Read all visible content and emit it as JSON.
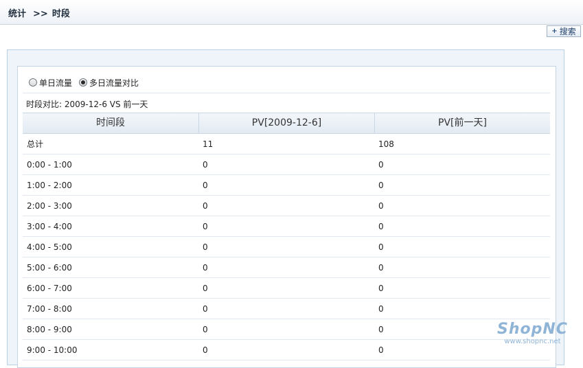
{
  "breadcrumb": {
    "root": "统计",
    "separator": ">>",
    "current": "时段"
  },
  "toolbar": {
    "search_plus": "+",
    "search_label": "搜索"
  },
  "mode": {
    "options": [
      {
        "label": "单日流量",
        "selected": false
      },
      {
        "label": "多日流量对比",
        "selected": true
      }
    ]
  },
  "compare_text": "时段对比: 2009-12-6 VS 前一天",
  "table": {
    "headers": [
      "时间段",
      "PV[2009-12-6]",
      "PV[前一天]"
    ],
    "rows": [
      [
        "总计",
        "11",
        "108"
      ],
      [
        "0:00 - 1:00",
        "0",
        "0"
      ],
      [
        "1:00 - 2:00",
        "0",
        "0"
      ],
      [
        "2:00 - 3:00",
        "0",
        "0"
      ],
      [
        "3:00 - 4:00",
        "0",
        "0"
      ],
      [
        "4:00 - 5:00",
        "0",
        "0"
      ],
      [
        "5:00 - 6:00",
        "0",
        "0"
      ],
      [
        "6:00 - 7:00",
        "0",
        "0"
      ],
      [
        "7:00 - 8:00",
        "0",
        "0"
      ],
      [
        "8:00 - 9:00",
        "0",
        "0"
      ],
      [
        "9:00 - 10:00",
        "0",
        "0"
      ]
    ]
  },
  "watermark": {
    "brand": "ShopNC",
    "url": "www.shopnc.net"
  },
  "colors": {
    "accent": "#8fb4d6",
    "header_bg": "#e2eaf2",
    "panel_bg": "#eef4fa"
  }
}
